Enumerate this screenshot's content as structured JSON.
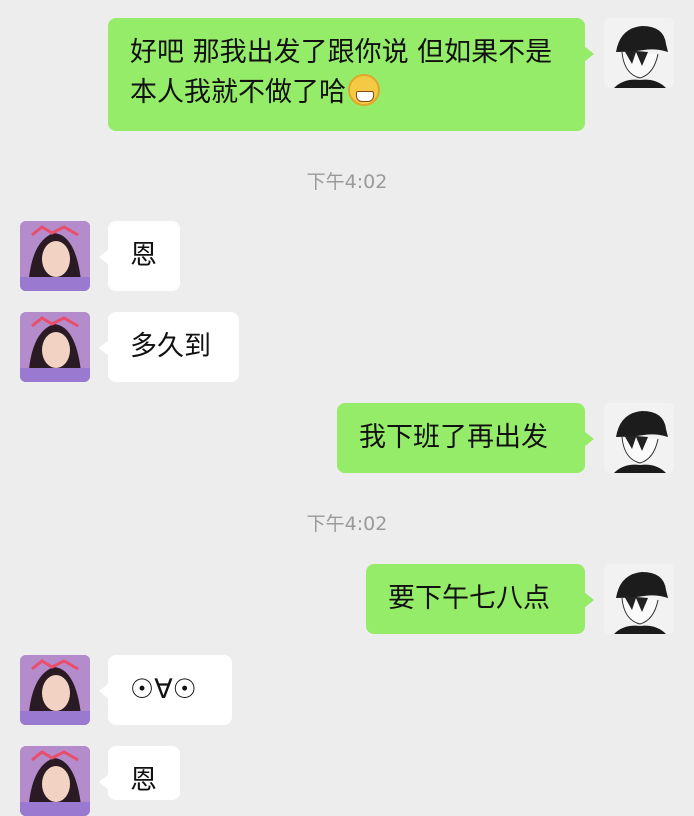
{
  "messages": [
    {
      "side": "self",
      "text": "好吧 那我出发了跟你说 但如果不是本人我就不做了哈",
      "emoji": "grinning-face"
    },
    {
      "type": "time",
      "text": "下午4:02"
    },
    {
      "side": "other",
      "text": "恩"
    },
    {
      "side": "other",
      "text": "多久到"
    },
    {
      "side": "self",
      "text": "我下班了再出发"
    },
    {
      "type": "time",
      "text": "下午4:02"
    },
    {
      "side": "self",
      "text": "要下午七八点"
    },
    {
      "side": "other",
      "text": "☉∀☉"
    },
    {
      "side": "other",
      "text": "恩"
    }
  ]
}
